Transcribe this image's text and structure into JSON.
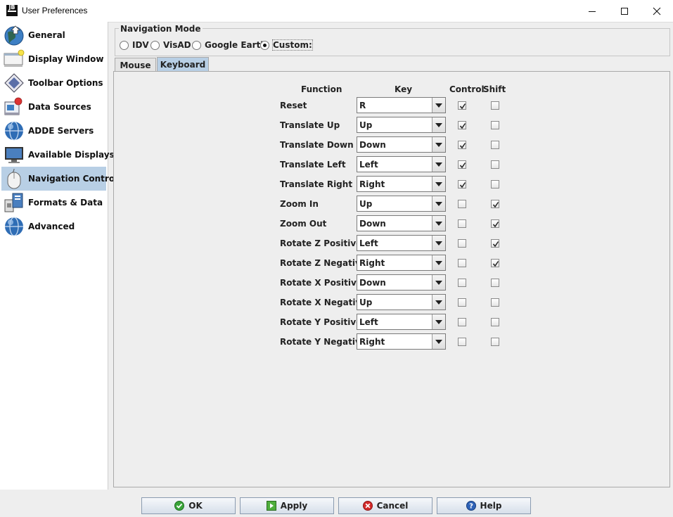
{
  "window": {
    "title": "User Preferences",
    "app_icon_text_top": "JB"
  },
  "sidebar": {
    "selected_index": 6,
    "items": [
      {
        "label": "General",
        "icon": "globe-arrow-icon"
      },
      {
        "label": "Display Window",
        "icon": "display-window-icon"
      },
      {
        "label": "Toolbar Options",
        "icon": "toolbar-diamond-icon"
      },
      {
        "label": "Data Sources",
        "icon": "data-sources-icon"
      },
      {
        "label": "ADDE Servers",
        "icon": "globe-icon"
      },
      {
        "label": "Available Displays",
        "icon": "monitor-icon"
      },
      {
        "label": "Navigation Controls",
        "icon": "mouse-icon"
      },
      {
        "label": "Formats & Data",
        "icon": "formats-data-icon"
      },
      {
        "label": "Advanced",
        "icon": "globe-icon"
      }
    ]
  },
  "navigation_mode": {
    "title": "Navigation Mode",
    "options": [
      "IDV",
      "VisAD",
      "Google Earth",
      "Custom:"
    ],
    "selected_index": 3
  },
  "tabs": {
    "items": [
      "Mouse",
      "Keyboard"
    ],
    "active_index": 1
  },
  "keyboard": {
    "headers": {
      "function": "Function",
      "key": "Key",
      "control": "Control",
      "shift": "Shift"
    },
    "rows": [
      {
        "function": "Reset",
        "key": "R",
        "control": true,
        "shift": false
      },
      {
        "function": "Translate Up",
        "key": "Up",
        "control": true,
        "shift": false
      },
      {
        "function": "Translate Down",
        "key": "Down",
        "control": true,
        "shift": false
      },
      {
        "function": "Translate Left",
        "key": "Left",
        "control": true,
        "shift": false
      },
      {
        "function": "Translate Right",
        "key": "Right",
        "control": true,
        "shift": false
      },
      {
        "function": "Zoom In",
        "key": "Up",
        "control": false,
        "shift": true
      },
      {
        "function": "Zoom Out",
        "key": "Down",
        "control": false,
        "shift": true
      },
      {
        "function": "Rotate Z Positive",
        "key": "Left",
        "control": false,
        "shift": true
      },
      {
        "function": "Rotate Z Negative",
        "key": "Right",
        "control": false,
        "shift": true
      },
      {
        "function": "Rotate X Positive",
        "key": "Down",
        "control": false,
        "shift": false
      },
      {
        "function": "Rotate X Negative",
        "key": "Up",
        "control": false,
        "shift": false
      },
      {
        "function": "Rotate Y Positive",
        "key": "Left",
        "control": false,
        "shift": false
      },
      {
        "function": "Rotate Y Negative",
        "key": "Right",
        "control": false,
        "shift": false
      }
    ]
  },
  "buttons": {
    "ok": "OK",
    "apply": "Apply",
    "cancel": "Cancel",
    "help": "Help"
  }
}
